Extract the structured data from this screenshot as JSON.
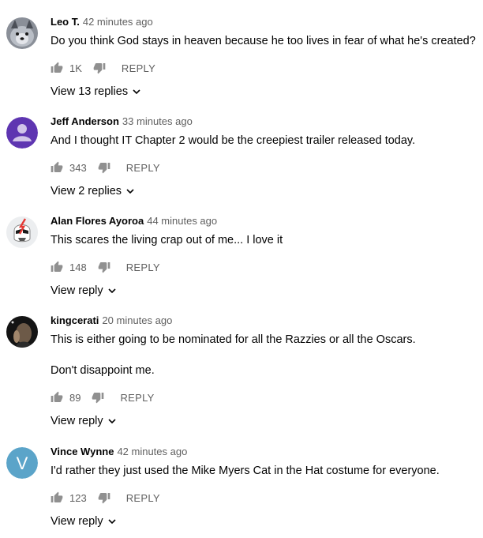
{
  "comments": [
    {
      "author": "Leo T.",
      "time": "42 minutes ago",
      "lines": [
        "Do you think God stays in heaven because he too lives in fear of what he's created?"
      ],
      "likes": "1K",
      "reply_label": "REPLY",
      "view_replies": "View 13 replies",
      "avatar_icon": "husky-photo-avatar"
    },
    {
      "author": "Jeff Anderson",
      "time": "33 minutes ago",
      "lines": [
        "And I thought IT Chapter 2 would be the creepiest trailer released today."
      ],
      "likes": "343",
      "reply_label": "REPLY",
      "view_replies": "View 2 replies",
      "avatar_icon": "default-person-avatar",
      "avatar_color": "#5e35b1"
    },
    {
      "author": "Alan Flores Ayoroa",
      "time": "44 minutes ago",
      "lines": [
        "This scares the living crap out of me... I love it"
      ],
      "likes": "148",
      "reply_label": "REPLY",
      "view_replies": "View reply",
      "avatar_icon": "stormtrooper-avatar"
    },
    {
      "author": "kingcerati",
      "time": "20 minutes ago",
      "lines": [
        "This is either going to be nominated for all the Razzies or all the Oscars.",
        "Don't disappoint me."
      ],
      "likes": "89",
      "reply_label": "REPLY",
      "view_replies": "View reply",
      "avatar_icon": "dark-photo-avatar"
    },
    {
      "author": "Vince Wynne",
      "time": "42 minutes ago",
      "lines": [
        "I'd rather they just used the Mike Myers Cat in the Hat costume for everyone."
      ],
      "likes": "123",
      "reply_label": "REPLY",
      "view_replies": "View reply",
      "avatar_icon": "letter-avatar",
      "avatar_letter": "V",
      "avatar_color": "#5ba4c9"
    }
  ],
  "icons": {
    "like": "thumb-up-icon",
    "dislike": "thumb-down-icon",
    "expand": "chevron-down-icon"
  }
}
